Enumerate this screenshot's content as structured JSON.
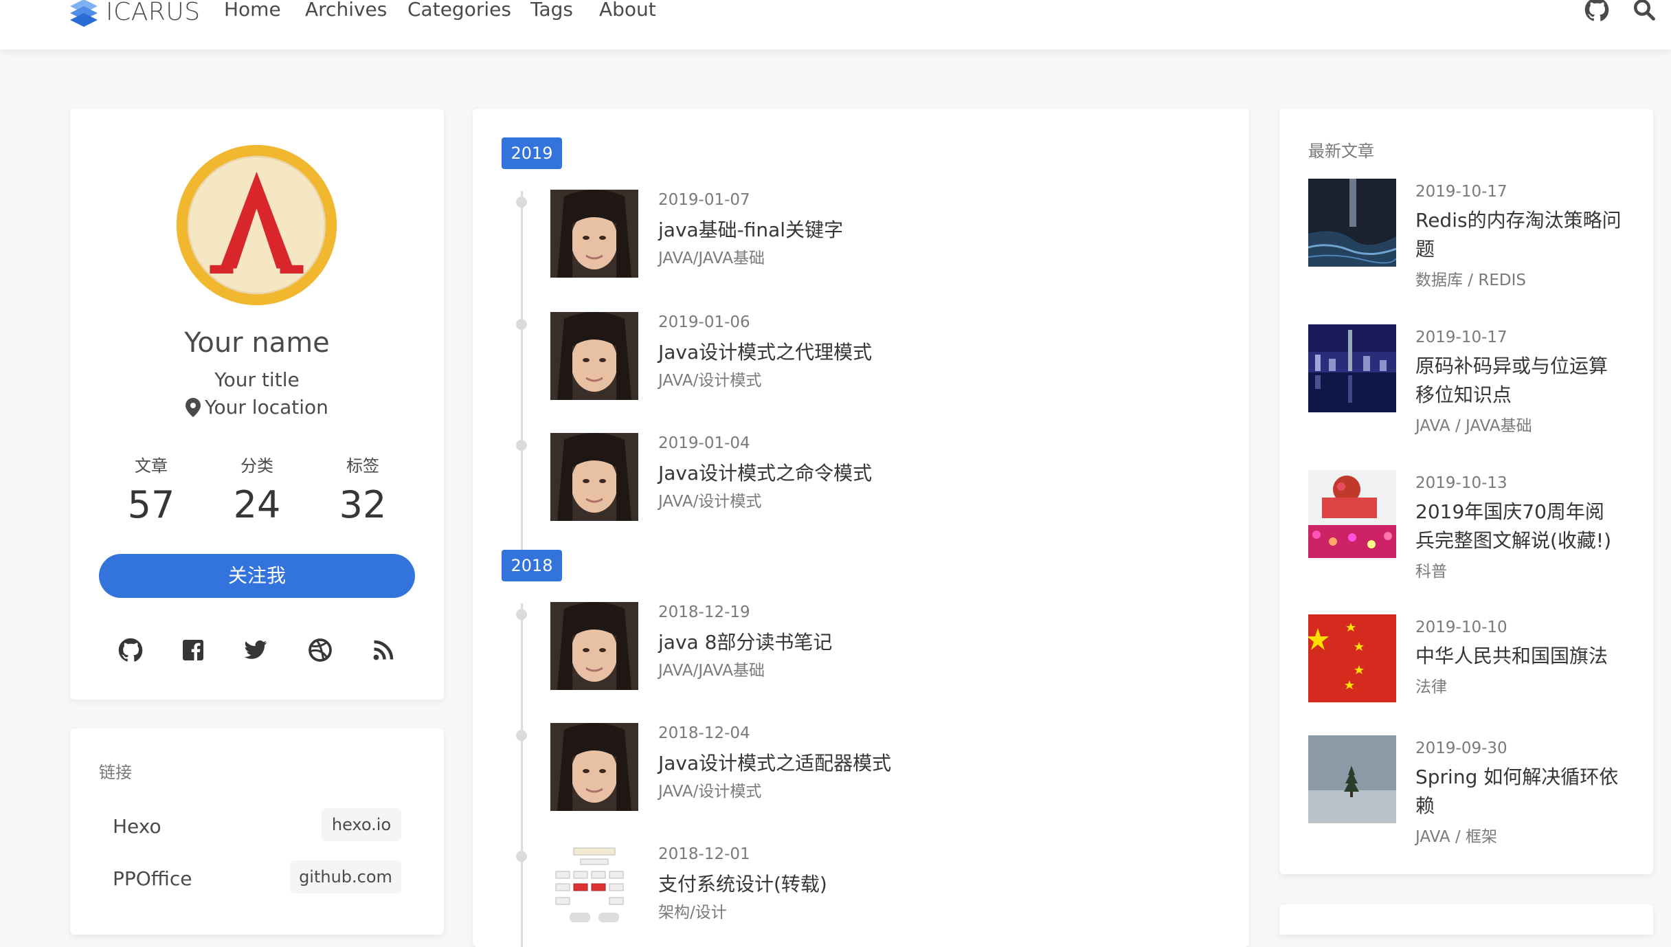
{
  "nav": {
    "logo": "ICARUS",
    "items": [
      "Home",
      "Archives",
      "Categories",
      "Tags",
      "About"
    ]
  },
  "profile": {
    "name": "Your name",
    "title": "Your title",
    "location": "Your location",
    "stats": [
      {
        "label": "文章",
        "value": "57"
      },
      {
        "label": "分类",
        "value": "24"
      },
      {
        "label": "标签",
        "value": "32"
      }
    ],
    "follow": "关注我",
    "socials": [
      "github-icon",
      "facebook-icon",
      "twitter-icon",
      "dribbble-icon",
      "rss-icon"
    ]
  },
  "links": {
    "heading": "链接",
    "items": [
      {
        "name": "Hexo",
        "host": "hexo.io"
      },
      {
        "name": "PPOffice",
        "host": "github.com"
      }
    ]
  },
  "archive": {
    "groups": [
      {
        "year": "2019",
        "posts": [
          {
            "date": "2019-01-07",
            "title": "java基础-final关键字",
            "category": "JAVA/JAVA基础"
          },
          {
            "date": "2019-01-06",
            "title": "Java设计模式之代理模式",
            "category": "JAVA/设计模式"
          },
          {
            "date": "2019-01-04",
            "title": "Java设计模式之命令模式",
            "category": "JAVA/设计模式"
          }
        ]
      },
      {
        "year": "2018",
        "posts": [
          {
            "date": "2018-12-19",
            "title": "java 8部分读书笔记",
            "category": "JAVA/JAVA基础"
          },
          {
            "date": "2018-12-04",
            "title": "Java设计模式之适配器模式",
            "category": "JAVA/设计模式"
          },
          {
            "date": "2018-12-01",
            "title": "支付系统设计(转载)",
            "category": "架构/设计"
          }
        ]
      }
    ]
  },
  "recent": {
    "heading": "最新文章",
    "items": [
      {
        "date": "2019-10-17",
        "title": "Redis的内存淘汰策略问题",
        "category": "数据库 / REDIS"
      },
      {
        "date": "2019-10-17",
        "title": "原码补码异或与位运算移位知识点",
        "category": "JAVA / JAVA基础"
      },
      {
        "date": "2019-10-13",
        "title": "2019年国庆70周年阅兵完整图文解说(收藏!)",
        "category": "科普"
      },
      {
        "date": "2019-10-10",
        "title": "中华人民共和国国旗法",
        "category": "法律"
      },
      {
        "date": "2019-09-30",
        "title": "Spring 如何解决循环依赖",
        "category": "JAVA / 框架"
      }
    ]
  },
  "colors": {
    "accent": "#3273dc",
    "background": "#f7f7f7"
  }
}
